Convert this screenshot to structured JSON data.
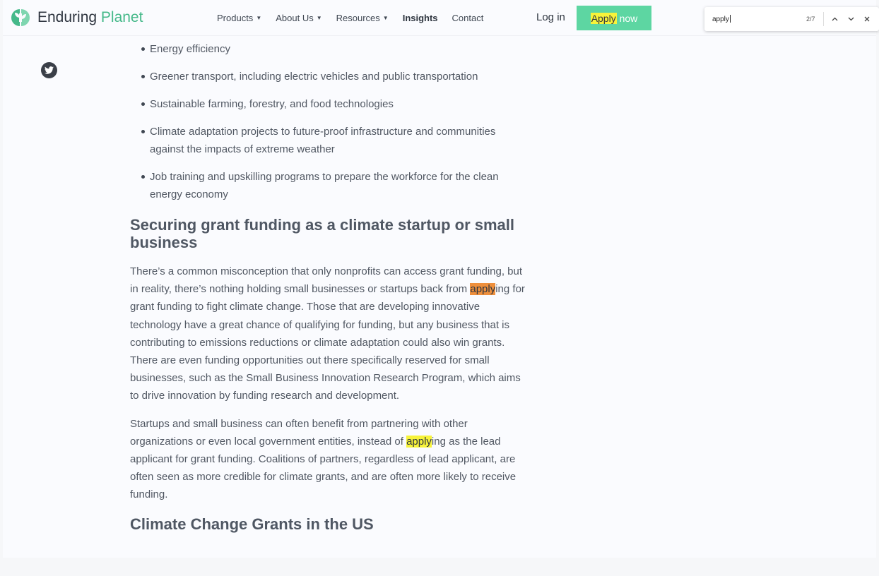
{
  "brand": {
    "name_part1": "Enduring ",
    "name_part2": "Planet"
  },
  "nav": {
    "items": [
      {
        "label": "Products",
        "dropdown": true
      },
      {
        "label": "About Us",
        "dropdown": true
      },
      {
        "label": "Resources",
        "dropdown": true
      },
      {
        "label": "Insights",
        "dropdown": false
      },
      {
        "label": "Contact",
        "dropdown": false
      }
    ],
    "login": "Log in",
    "apply_highlight": "Apply",
    "apply_rest": " now"
  },
  "findbar": {
    "query": "apply",
    "count": "2/7",
    "prev_icon": "chevron-up-icon",
    "next_icon": "chevron-down-icon",
    "close_icon": "close-icon"
  },
  "share": {
    "icon": "twitter-icon"
  },
  "article": {
    "bullets": [
      "Energy efficiency",
      "Greener transport, including electric vehicles and public transportation",
      "Sustainable farming, forestry, and food technologies",
      "Climate adaptation projects to future-proof infrastructure and communities against the impacts of extreme weather",
      "Job training and upskilling programs to prepare the workforce for the clean energy economy"
    ],
    "heading_1": "Securing grant funding as a climate startup or small business",
    "p1_before": "There’s a common misconception that only nonprofits can access grant funding, but in reality, there’s nothing holding small businesses or startups back from ",
    "p1_highlight": "apply",
    "p1_after": "ing for grant funding to fight climate change. Those that are developing innovative technology have a great chance of qualifying for funding, but any business that is contributing to emissions reductions or climate adaptation could also win grants. There are even funding opportunities out there specifically reserved for small businesses, such as the Small Business Innovation Research Program, which aims to drive innovation by funding research and development.",
    "p2_before": "Startups and small business can often benefit from partnering with other organizations or even local government entities, instead of ",
    "p2_highlight": "apply",
    "p2_after": "ing as the lead applicant for grant funding. Coalitions of partners, regardless of lead applicant, are often seen as more credible for climate grants, and are often more likely to receive funding.",
    "heading_2": "Climate Change Grants in the US"
  },
  "colors": {
    "accent": "#5dd6a2",
    "brand_green": "#46b98a",
    "current_match": "#ee8f3c",
    "other_match": "#f7f33a"
  }
}
